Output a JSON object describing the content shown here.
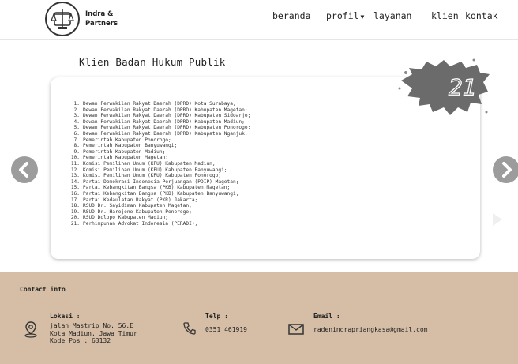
{
  "header": {
    "brand_line1": "Indra &",
    "brand_line2": "Partners",
    "nav": {
      "beranda": "beranda",
      "profil": "profil",
      "layanan": "layanan",
      "klien": "klien",
      "kontak": "kontak"
    }
  },
  "section": {
    "title": "Klien Badan Hukum Publik",
    "badge_number": "21"
  },
  "clients": [
    "Dewan Perwakilan Rakyat Daerah (DPRD) Kota Surabaya;",
    "Dewan Perwakilan Rakyat Daerah (DPRD) Kabupaten Magetan;",
    "Dewan Perwakilan Rakyat Daerah (DPRD) Kabupaten Sidoarjo;",
    "Dewan Perwakilan Rakyat Daerah (DPRD) Kabupaten Madiun;",
    "Dewan Perwakilan Rakyat Daerah (DPRD) Kabupaten Ponorogo;",
    "Dewan Perwakilan Rakyat Daerah (DPRD) Kabupaten Nganjuk;",
    "Pemerintah Kabupaten Ponorogo;",
    "Pemerintah Kabupaten Banyuwangi;",
    "Pemerintah Kabupaten Madiun;",
    "Pemerintah Kabupaten Magetan;",
    "Komisi Pemilihan Umum (KPU) Kabupaten Madiun;",
    "Komisi Pemilihan Umum (KPU) Kabupaten Banyuwangi;",
    "Komisi Pemilihan Umum (KPU) Kabupaten Ponorogo;",
    "Partai Demokrasi Indonesia Perjuangan (PDIP) Magetan;",
    "Partai Kebangkitan Bangsa (PKB) Kabupaten Magetan;",
    "Partai Kebangkitan Bangsa (PKB) Kabupaten Banyuwangi;",
    "Partai Kedaulatan Rakyat (PKR) Jakarta;",
    "RSUD Dr. Sayidiman Kabupaten Magetan;",
    "RSUD Dr. Harojono Kabupaten Ponorogo;",
    "RSUD Dolopo Kabupaten Madiun;",
    "Perhimpunan Advokat Indonesia (PERADI);"
  ],
  "footer": {
    "heading": "Contact info",
    "lokasi_label": "Lokasi :",
    "lokasi_line1": "jalan Mastrip No. 56.E",
    "lokasi_line2": "Kota Madiun, Jawa Timur",
    "lokasi_line3": "Kode Pos : 63132",
    "telp_label": "Telp :",
    "telp_value": "0351 461919",
    "email_label": "Email :",
    "email_value": "radenindrapriangkasa@gmail.com"
  },
  "icons": {
    "logo": "scales-of-justice-logo",
    "prev": "chevron-left-icon",
    "next": "chevron-right-icon",
    "location": "location-pin-icon",
    "phone": "phone-icon",
    "email": "envelope-icon"
  },
  "colors": {
    "footer_bg": "#d5bea5",
    "arrow_bg": "#9c9c9c",
    "badge_gray": "#6b6b6b"
  }
}
